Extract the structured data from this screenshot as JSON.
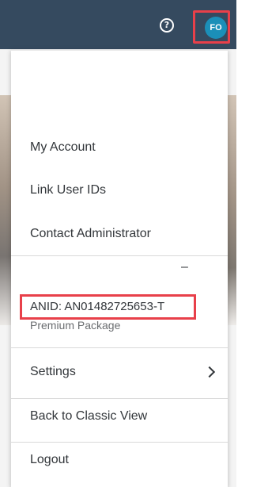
{
  "header": {
    "help_icon_glyph": "?",
    "avatar_initials": "FO",
    "colors": {
      "topbar": "#354a5f",
      "avatar": "#1b8fb8",
      "highlight": "#e8404a"
    }
  },
  "menu": {
    "items": [
      {
        "label": "My Account"
      },
      {
        "label": "Link User IDs"
      },
      {
        "label": "Contact Administrator"
      }
    ],
    "minus_glyph": "–",
    "anid": "ANID: AN01482725653-T",
    "package": "Premium Package",
    "settings_label": "Settings",
    "back_label": "Back to Classic View",
    "logout_label": "Logout"
  }
}
